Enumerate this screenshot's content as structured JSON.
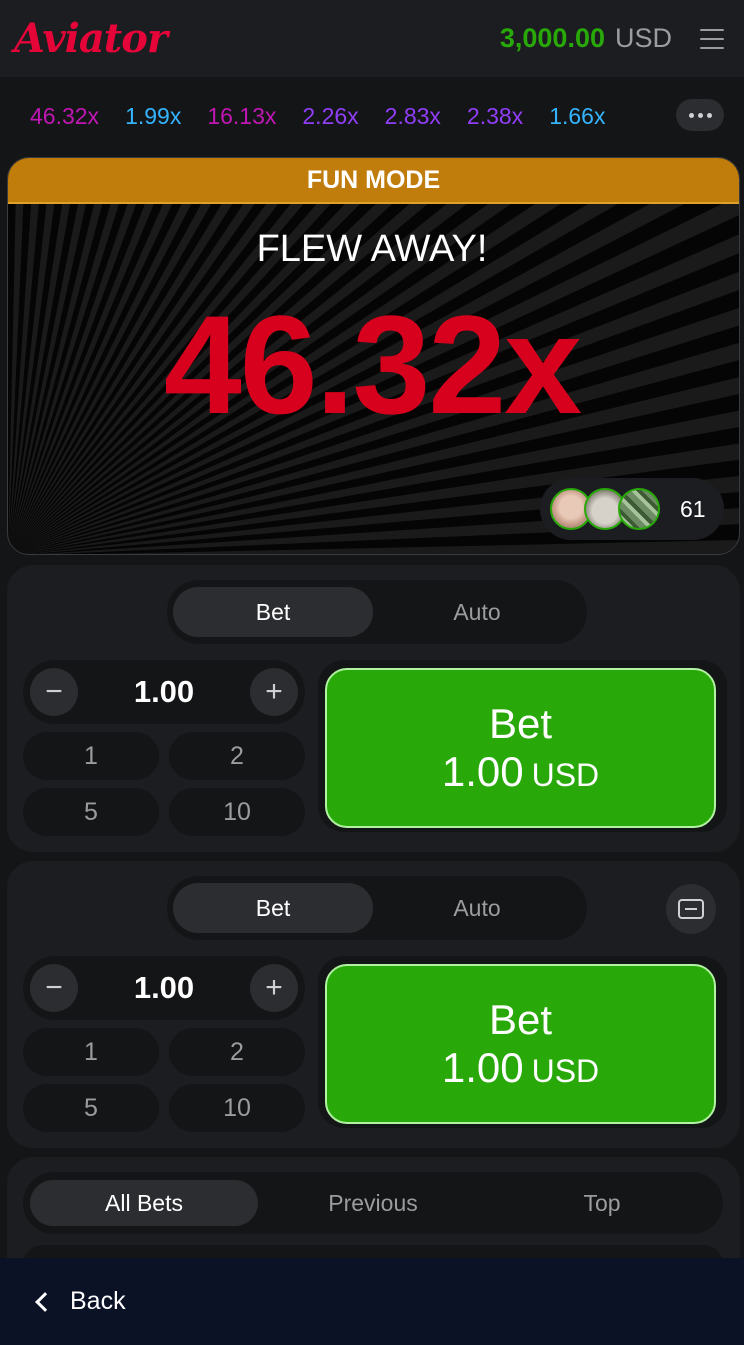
{
  "header": {
    "logo_text": "Aviator",
    "balance_amount": "3,000.00",
    "balance_currency": "USD",
    "menu_icon": "hamburger-menu-icon"
  },
  "history": {
    "multipliers": [
      {
        "value": "46.32x",
        "color": "#c017b4"
      },
      {
        "value": "1.99x",
        "color": "#34b4ff"
      },
      {
        "value": "16.13x",
        "color": "#c017b4"
      },
      {
        "value": "2.26x",
        "color": "#913ef8"
      },
      {
        "value": "2.83x",
        "color": "#913ef8"
      },
      {
        "value": "2.38x",
        "color": "#913ef8"
      },
      {
        "value": "1.66x",
        "color": "#34b4ff"
      }
    ],
    "more_icon": "more-dots-icon"
  },
  "game": {
    "mode_banner": "FUN MODE",
    "status": "FLEW AWAY!",
    "multiplier": "46.32x",
    "multiplier_color": "#d7001d",
    "players_count": "61"
  },
  "bet_panels": [
    {
      "tab_active": "Bet",
      "tab_inactive": "Auto",
      "amount": "1.00",
      "quick_amounts": [
        "1",
        "2",
        "5",
        "10"
      ],
      "bet_label": "Bet",
      "bet_amount": "1.00",
      "bet_currency": "USD"
    },
    {
      "tab_active": "Bet",
      "tab_inactive": "Auto",
      "amount": "1.00",
      "quick_amounts": [
        "1",
        "2",
        "5",
        "10"
      ],
      "bet_label": "Bet",
      "bet_amount": "1.00",
      "bet_currency": "USD",
      "remove_icon": "remove-panel-icon"
    }
  ],
  "bets_tabs": {
    "all": "All Bets",
    "previous": "Previous",
    "top": "Top"
  },
  "footer": {
    "back_label": "Back"
  },
  "colors": {
    "accent_green": "#28a909",
    "brand_red": "#e50539",
    "fun_mode_orange": "#c17d0c",
    "back_bar": "#0b1226"
  }
}
